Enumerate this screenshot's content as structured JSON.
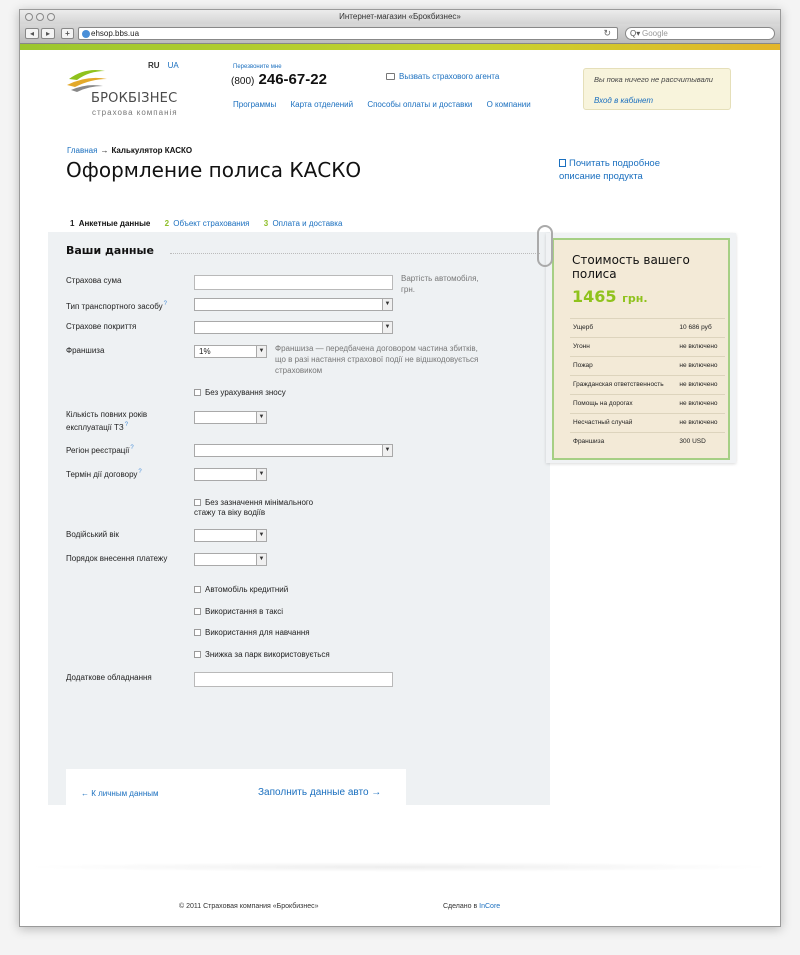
{
  "window": {
    "title": "Интернет-магазин «Брокбизнес»"
  },
  "browser": {
    "url": "ehsop.bbs.ua",
    "search_placeholder": "Google"
  },
  "header": {
    "logo_title": "БРОКБІЗНЕС",
    "logo_sub": "страхова компанія",
    "lang_ru": "RU",
    "lang_ua": "UA",
    "callback": "Перезвоните мне",
    "phone_code": "(800)",
    "phone_number": "246-67-22",
    "agent_link": "Вызвать страхового агента",
    "nav": [
      "Программы",
      "Карта отделений",
      "Способы оплаты и доставки",
      "О компании"
    ],
    "login_msg": "Вы пока ничего не рассчитывали",
    "login_link": "Вход в кабинет"
  },
  "breadcrumb": {
    "home": "Главная",
    "arrow": "→",
    "current": "Калькулятор КАСКО"
  },
  "page_title": "Оформление полиса КАСКО",
  "product_link": "Почитать подробное описание продукта",
  "steps": [
    {
      "num": "1",
      "label": "Анкетные данные"
    },
    {
      "num": "2",
      "label": "Объект страхования"
    },
    {
      "num": "3",
      "label": "Оплата и доставка"
    }
  ],
  "form": {
    "section_title": "Ваши данные",
    "sum_label": "Страхова сума",
    "sum_value": "",
    "sum_hint": "Вартість автомобіля, грн.",
    "vehicle_type_label": "Тип транспортного засобу",
    "coverage_label": "Страхове покриття",
    "franchise_label": "Франшиза",
    "franchise_value": "1%",
    "franchise_hint": "Франшиза — передбачена договором частина збитків, що в разі настання страхової події не відшкодовується страховиком",
    "no_wear_label": "Без урахування зносу",
    "years_label": "Кількість повних років експлуатації ТЗ",
    "region_label": "Регіон реєстрації",
    "term_label": "Термін дії договору",
    "no_experience_label": "Без зазначення мінімального стажу та віку водіїв",
    "driver_age_label": "Водійський вік",
    "payment_order_label": "Порядок внесення платежу",
    "credit_label": "Автомобіль кредитний",
    "taxi_label": "Використання в таксі",
    "training_label": "Використання для навчання",
    "fleet_label": "Знижка за парк використовується",
    "equipment_label": "Додаткове обладнання",
    "equipment_value": "",
    "help_mark": "?",
    "prev_link": "← К личным данным",
    "next_link": "Заполнить данные авто →"
  },
  "price": {
    "title": "Стоимость вашего полиса",
    "amount": "1465",
    "currency": "грн.",
    "rows": [
      {
        "name": "Ущерб",
        "value": "10 686 руб"
      },
      {
        "name": "Угонн",
        "value": "не включено"
      },
      {
        "name": "Пожар",
        "value": "не включено"
      },
      {
        "name": "Гражданская ответственность",
        "value": "не включено"
      },
      {
        "name": "Помощь на дорогах",
        "value": "не включено"
      },
      {
        "name": "Несчастный случай",
        "value": "не включено"
      },
      {
        "name": "Франшиза",
        "value": "300 USD"
      }
    ]
  },
  "footer": {
    "copyright": "© 2011 Страховая компания «Брокбизнес»",
    "made_text": "Сделано в",
    "made_link": "InCore"
  },
  "colors": {
    "accent_green": "#8fc21c",
    "link_blue": "#1a6fbf",
    "card_bg": "#f3ead7"
  }
}
